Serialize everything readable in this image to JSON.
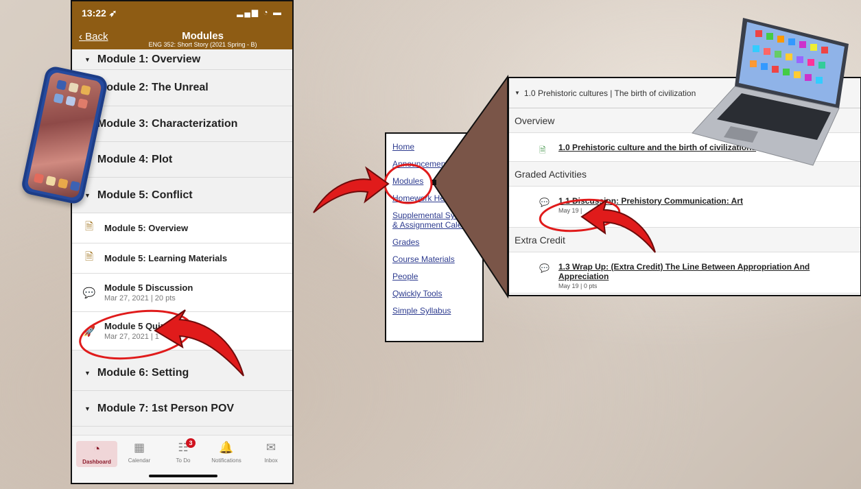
{
  "phone": {
    "status_time": "13:22 ➶",
    "status_icons": "▂▄▆ ◔ ▬",
    "back_label": "Back",
    "nav_title": "Modules",
    "nav_subtitle": "ENG 352: Short Story (2021 Spring - B)",
    "modules": [
      "Module 1: Overview",
      "Module 2: The Unreal",
      "Module 3: Characterization",
      "Module 4: Plot",
      "Module 5: Conflict",
      "Module 6: Setting",
      "Module 7: 1st Person POV"
    ],
    "items": [
      {
        "title": "Module 5: Overview",
        "icon": "page-icon"
      },
      {
        "title": "Module 5: Learning Materials",
        "icon": "page-icon"
      },
      {
        "title": "Module 5 Discussion",
        "meta": "Mar 27, 2021 | 20 pts",
        "icon": "discussion-icon"
      },
      {
        "title": "Module 5 Quiz",
        "meta": "Mar 27, 2021 | 1",
        "icon": "rocket-icon"
      }
    ],
    "tabs": [
      {
        "label": "Dashboard",
        "icon": "dashboard-icon"
      },
      {
        "label": "Calendar",
        "icon": "calendar-icon"
      },
      {
        "label": "To Do",
        "icon": "todo-icon",
        "badge": "3"
      },
      {
        "label": "Notifications",
        "icon": "bell-icon"
      },
      {
        "label": "Inbox",
        "icon": "envelope-icon"
      }
    ]
  },
  "course_nav": {
    "links": [
      "Home",
      "Announcements",
      "Modules",
      "Homework Help",
      "Supplemental Syllabus & Assignment Calendar",
      "Grades",
      "Course Materials",
      "People",
      "Qwickly Tools",
      "Simple Syllabus"
    ]
  },
  "desktop": {
    "module_title": "1.0 Prehistoric cultures | The birth of civilization",
    "sections": [
      {
        "title": "Overview",
        "items": [
          {
            "title": "1.0 Prehistoric culture and the birth of civilizations",
            "icon": "page-icon"
          }
        ]
      },
      {
        "title": "Graded Activities",
        "items": [
          {
            "title": "1.1 Discussion: Prehistory Communication: Art",
            "meta": "May 19 |",
            "icon": "discussion-icon"
          }
        ]
      },
      {
        "title": "Extra Credit",
        "items": [
          {
            "title": "1.3 Wrap Up: (Extra Credit) The Line Between Appropriation And Appreciation",
            "meta": "May 19 | 0 pts",
            "icon": "discussion-icon"
          }
        ]
      }
    ]
  },
  "colors": {
    "canvas_header": "#8e5c14",
    "annotation_red": "#e01b1b",
    "link_blue": "#2d3b8f",
    "connector_brown": "#7a5548"
  }
}
